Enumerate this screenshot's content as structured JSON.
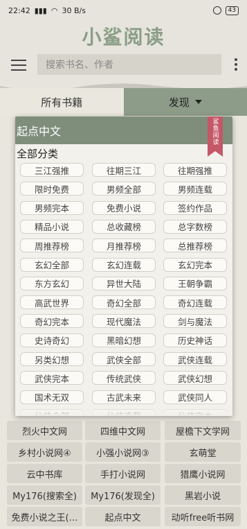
{
  "status": {
    "time": "22:42",
    "signal": "4G",
    "wifi_speed": "30 B/s",
    "battery": "43"
  },
  "brand": {
    "title": "小鲨阅读"
  },
  "search": {
    "placeholder": "搜索书名、作者"
  },
  "tabs": {
    "all": "所有书籍",
    "discover": "发现"
  },
  "panel": {
    "source": "起点中文",
    "bookmark_label": "鲨鱼阅读",
    "section": "全部分类",
    "chips": [
      "三江强推",
      "往期三江",
      "往期强推",
      "限时免费",
      "男频全部",
      "男频连载",
      "男频完本",
      "免费小说",
      "签约作品",
      "精品小说",
      "总收藏榜",
      "总字数榜",
      "周推荐榜",
      "月推荐榜",
      "总推荐榜",
      "玄幻全部",
      "玄幻连载",
      "玄幻完本",
      "东方玄幻",
      "异世大陆",
      "王朝争霸",
      "高武世界",
      "奇幻全部",
      "奇幻连载",
      "奇幻完本",
      "现代魔法",
      "剑与魔法",
      "史诗奇幻",
      "黑暗幻想",
      "历史神话",
      "另类幻想",
      "武侠全部",
      "武侠连载",
      "武侠完本",
      "传统武侠",
      "武侠幻想",
      "国术无双",
      "古武未来",
      "武侠同人",
      "仙侠全部",
      "仙侠连载",
      "仙侠完本"
    ]
  },
  "sources": [
    "烈火中文网",
    "四维中文网",
    "屋檐下文学网",
    "乡村小说网④",
    "小强小说网③",
    "玄萌堂",
    "云中书库",
    "手打小说网",
    "猎鹰小说网",
    "My176(搜索全)",
    "My176(发现全)",
    "黑岩小说",
    "免费小说之王(…",
    "起点中文",
    "动听free听书网"
  ],
  "colors": {
    "accent": "#8d9c88",
    "bookmark": "#c45867",
    "brand": "#8a9e86"
  }
}
